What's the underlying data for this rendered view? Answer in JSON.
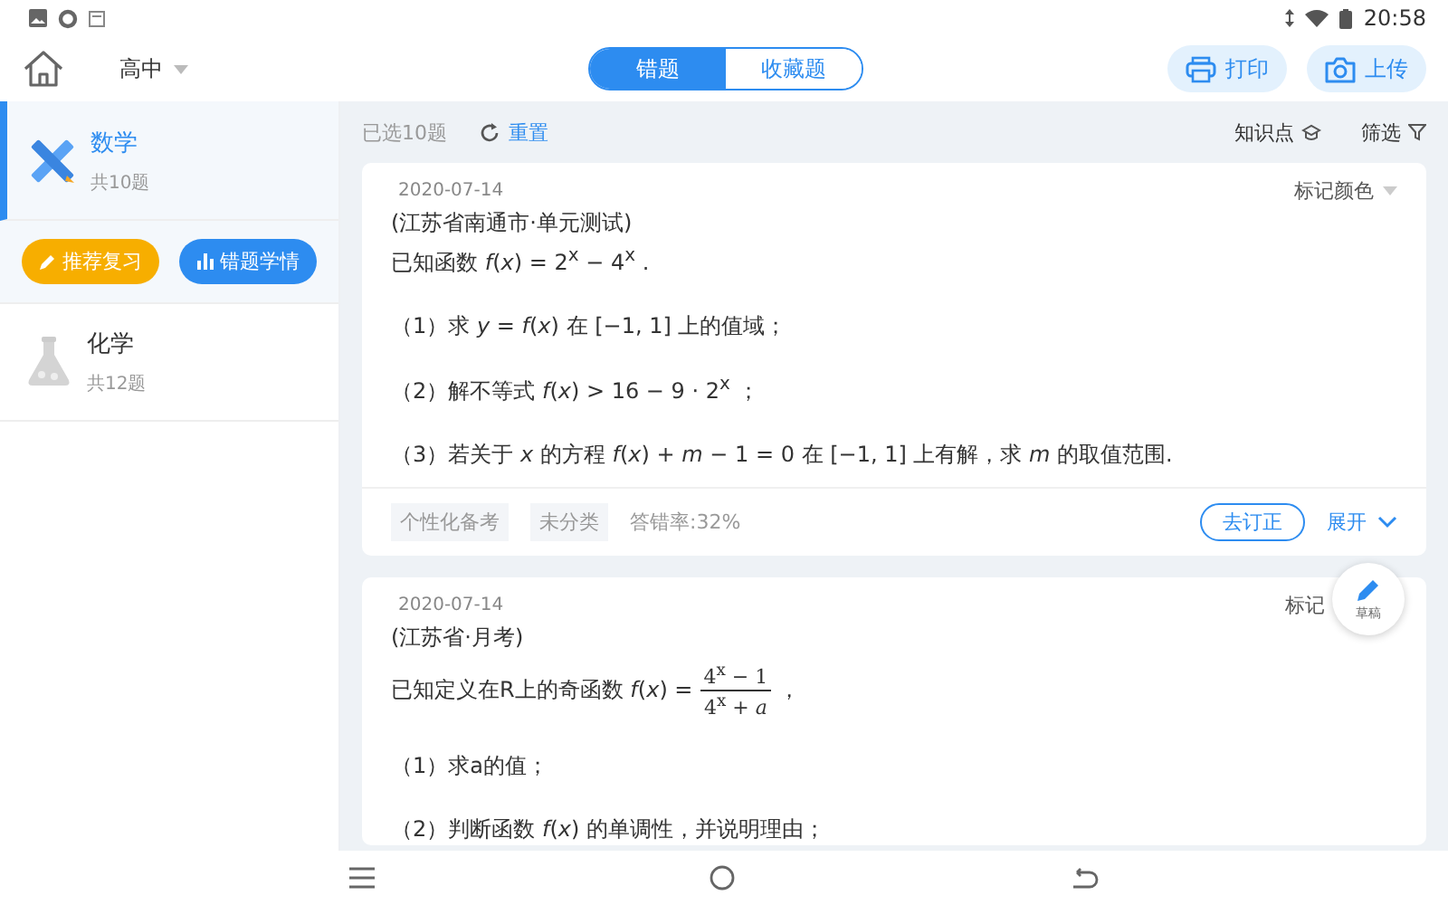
{
  "status_bar": {
    "time": "20:58"
  },
  "header": {
    "grade": "高中",
    "tabs": [
      {
        "label": "错题",
        "selected": true
      },
      {
        "label": "收藏题",
        "selected": false
      }
    ],
    "actions": [
      {
        "kind": "print",
        "label": "打印"
      },
      {
        "kind": "upload",
        "label": "上传"
      }
    ]
  },
  "sidebar": {
    "items": [
      {
        "kind": "math",
        "name": "数学",
        "count": "共10题",
        "selected": true
      },
      {
        "kind": "chemistry",
        "name": "化学",
        "count": "共12题",
        "selected": false
      }
    ],
    "buttons": [
      {
        "kind": "review",
        "label": "推荐复习"
      },
      {
        "kind": "stats",
        "label": "错题学情"
      }
    ]
  },
  "toolbar": {
    "selected_count": "已选10题",
    "reset": "重置",
    "filters": [
      {
        "kind": "knowledge",
        "label": "知识点"
      },
      {
        "kind": "filter",
        "label": "筛选"
      }
    ]
  },
  "cards": [
    {
      "date": "2020-07-14",
      "mark": "标记颜色",
      "mark_caret": true,
      "source": "(江苏省南通市·单元测试)",
      "stem": {
        "kind": "text",
        "text": "已知函数 *f*(*x*) = 2$^{x}$ − 4$^{x}$ ."
      },
      "parts": [
        "（1）求 *y* = *f*(*x*) 在 [−1, 1] 上的值域；",
        "（2）解不等式 *f*(*x*) > 16 − 9 · 2$^{x}$ ；",
        "（3）若关于 *x* 的方程 *f*(*x*) + *m* − 1 = 0 在 [−1, 1] 上有解，求 *m* 的取值范围."
      ],
      "tags": [
        "个性化备考",
        "未分类"
      ],
      "error_rate": "答错率:32%",
      "fix": "去订正",
      "expand": "展开"
    },
    {
      "date": "2020-07-14",
      "mark": "标记",
      "mark_caret": false,
      "source": "(江苏省·月考)",
      "stem": {
        "kind": "fraction",
        "prefix": "已知定义在R上的奇函数 *f*(*x*) =",
        "numerator": "4$^{x}$ − 1",
        "denominator": "4$^{x}$ + *a*",
        "suffix": "，"
      },
      "parts": [
        "（1）求a的值；",
        "（2）判断函数 *f*(*x*) 的单调性，并说明理由；"
      ]
    }
  ],
  "draft_button": {
    "label": "草稿"
  }
}
